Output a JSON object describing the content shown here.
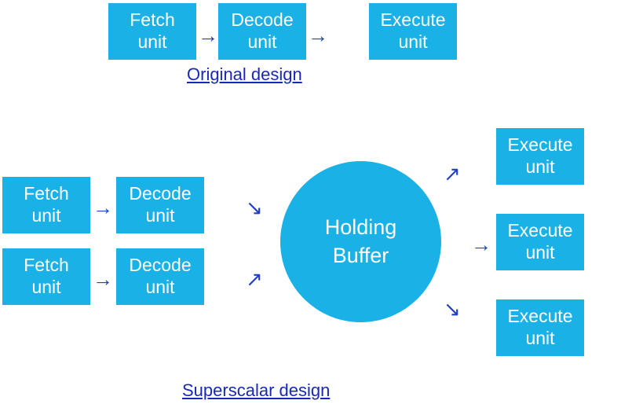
{
  "colors": {
    "block_fill": "#1ab1e6",
    "block_text": "#ffffff",
    "arrow": "#1e3fcc",
    "caption": "#1928b8"
  },
  "top": {
    "fetch": {
      "line1": "Fetch",
      "line2": "unit"
    },
    "decode": {
      "line1": "Decode",
      "line2": "unit"
    },
    "execute": {
      "line1": "Execute",
      "line2": "unit"
    },
    "caption": "Original design"
  },
  "bottom": {
    "fetch1": {
      "line1": "Fetch",
      "line2": "unit"
    },
    "fetch2": {
      "line1": "Fetch",
      "line2": "unit"
    },
    "decode1": {
      "line1": "Decode",
      "line2": "unit"
    },
    "decode2": {
      "line1": "Decode",
      "line2": "unit"
    },
    "buffer": {
      "line1": "Holding",
      "line2": "Buffer"
    },
    "exec1": {
      "line1": "Execute",
      "line2": "unit"
    },
    "exec2": {
      "line1": "Execute",
      "line2": "unit"
    },
    "exec3": {
      "line1": "Execute",
      "line2": "unit"
    },
    "caption": "Superscalar design"
  },
  "glyphs": {
    "arrow_right": "→",
    "arrow_upright": "↗",
    "arrow_downright": "↘"
  }
}
